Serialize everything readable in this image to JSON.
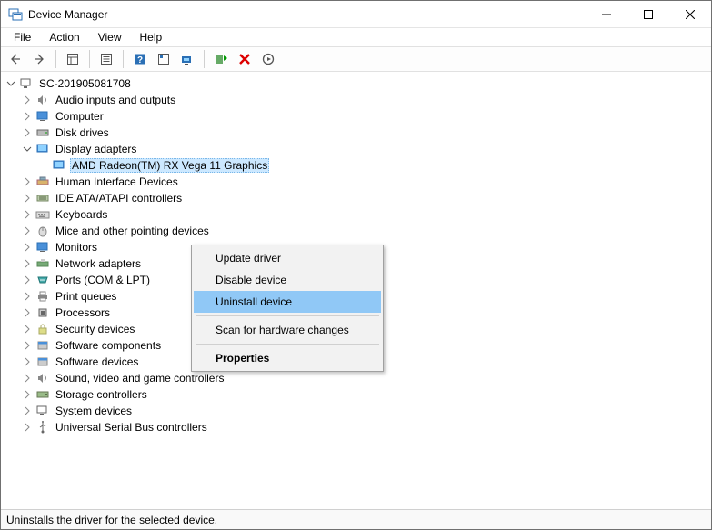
{
  "window": {
    "title": "Device Manager"
  },
  "menu": {
    "file": "File",
    "action": "Action",
    "view": "View",
    "help": "Help"
  },
  "tree": {
    "root": "SC-201905081708",
    "items": [
      "Audio inputs and outputs",
      "Computer",
      "Disk drives",
      "Display adapters",
      "Human Interface Devices",
      "IDE ATA/ATAPI controllers",
      "Keyboards",
      "Mice and other pointing devices",
      "Monitors",
      "Network adapters",
      "Ports (COM & LPT)",
      "Print queues",
      "Processors",
      "Security devices",
      "Software components",
      "Software devices",
      "Sound, video and game controllers",
      "Storage controllers",
      "System devices",
      "Universal Serial Bus controllers"
    ],
    "display_child": "AMD Radeon(TM) RX Vega 11 Graphics"
  },
  "context": {
    "update": "Update driver",
    "disable": "Disable device",
    "uninstall": "Uninstall device",
    "scan": "Scan for hardware changes",
    "properties": "Properties"
  },
  "status": "Uninstalls the driver for the selected device."
}
